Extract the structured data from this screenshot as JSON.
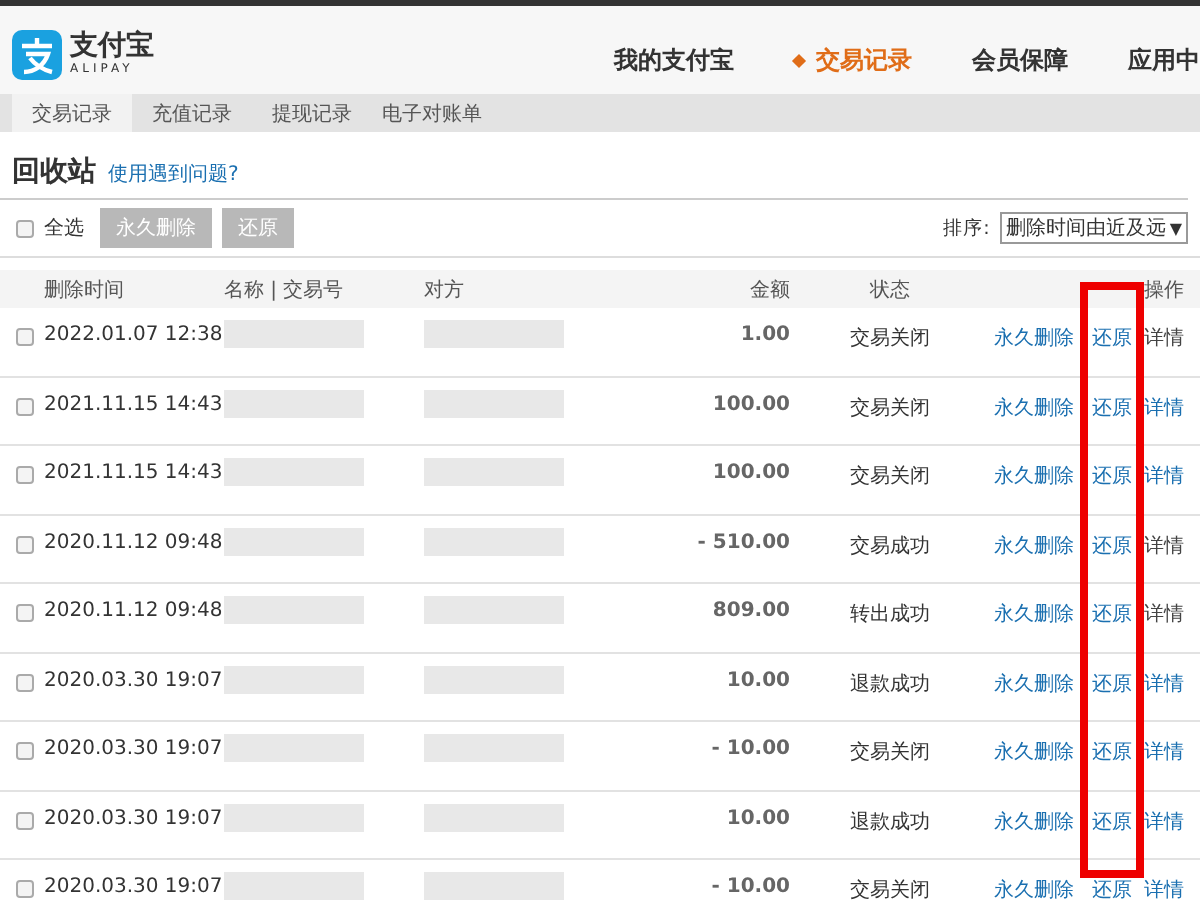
{
  "header": {
    "logo_text": "支付宝",
    "logo_sub": "ALIPAY",
    "nav": [
      {
        "label": "我的支付宝",
        "selected": false
      },
      {
        "label": "交易记录",
        "selected": true
      },
      {
        "label": "会员保障",
        "selected": false
      },
      {
        "label": "应用中",
        "selected": false
      }
    ]
  },
  "subnav": [
    {
      "label": "交易记录",
      "selected": true
    },
    {
      "label": "充值记录",
      "selected": false
    },
    {
      "label": "提现记录",
      "selected": false
    },
    {
      "label": "电子对账单",
      "selected": false
    }
  ],
  "page_title": "回收站",
  "help_link": "使用遇到问题?",
  "toolbar": {
    "select_all": {
      "label": "全选",
      "checked": false
    },
    "buttons": [
      {
        "label": "永久删除",
        "disabled": true
      },
      {
        "label": "还原",
        "disabled": true
      }
    ],
    "sort_label": "排序:",
    "sort_value": "删除时间由近及远",
    "sort_arrow": "▼"
  },
  "table": {
    "columns": [
      "删除时间",
      "名称 | 交易号",
      "对方",
      "金额",
      "状态",
      "操作"
    ],
    "rows": [
      {
        "checked": false,
        "time": "2022.01.07 12:38",
        "amount": "1.00",
        "status": "交易关闭",
        "delete": "永久删除",
        "restore": "还原",
        "detail": "详情",
        "detail_linked": false
      },
      {
        "checked": false,
        "time": "2021.11.15 14:43",
        "amount": "100.00",
        "status": "交易关闭",
        "delete": "永久删除",
        "restore": "还原",
        "detail": "详情",
        "detail_linked": true
      },
      {
        "checked": false,
        "time": "2021.11.15 14:43",
        "amount": "100.00",
        "status": "交易关闭",
        "delete": "永久删除",
        "restore": "还原",
        "detail": "详情",
        "detail_linked": true
      },
      {
        "checked": false,
        "time": "2020.11.12 09:48",
        "amount": "- 510.00",
        "status": "交易成功",
        "delete": "永久删除",
        "restore": "还原",
        "detail": "详情",
        "detail_linked": false
      },
      {
        "checked": false,
        "time": "2020.11.12 09:48",
        "amount": "809.00",
        "status": "转出成功",
        "delete": "永久删除",
        "restore": "还原",
        "detail": "详情",
        "detail_linked": false
      },
      {
        "checked": false,
        "time": "2020.03.30 19:07",
        "amount": "10.00",
        "status": "退款成功",
        "delete": "永久删除",
        "restore": "还原",
        "detail": "详情",
        "detail_linked": true
      },
      {
        "checked": false,
        "time": "2020.03.30 19:07",
        "amount": "- 10.00",
        "status": "交易关闭",
        "delete": "永久删除",
        "restore": "还原",
        "detail": "详情",
        "detail_linked": true
      },
      {
        "checked": false,
        "time": "2020.03.30 19:07",
        "amount": "10.00",
        "status": "退款成功",
        "delete": "永久删除",
        "restore": "还原",
        "detail": "详情",
        "detail_linked": true
      },
      {
        "checked": false,
        "time": "2020.03.30 19:07",
        "amount": "- 10.00",
        "status": "交易关闭",
        "delete": "永久删除",
        "restore": "还原",
        "detail": "详情",
        "detail_linked": true
      }
    ]
  },
  "restore_column_highlighted": true
}
